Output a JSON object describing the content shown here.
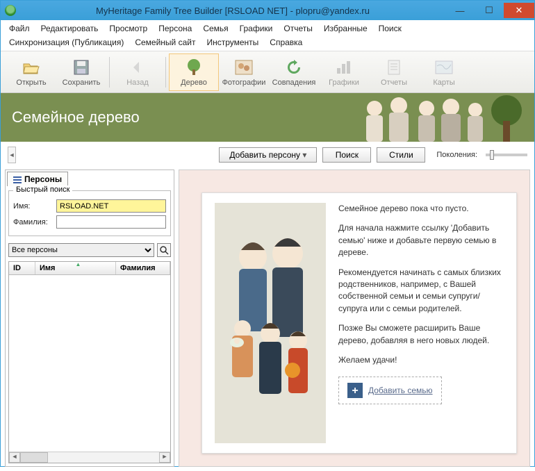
{
  "window": {
    "title": "MyHeritage Family Tree Builder [RSLOAD NET] - plopru@yandex.ru"
  },
  "menu": [
    "Файл",
    "Редактировать",
    "Просмотр",
    "Персона",
    "Семья",
    "Графики",
    "Отчеты",
    "Избранные",
    "Поиск",
    "Синхронизация (Публикация)",
    "Семейный сайт",
    "Инструменты",
    "Справка"
  ],
  "toolbar": {
    "open": "Открыть",
    "save": "Сохранить",
    "back": "Назад",
    "tree": "Дерево",
    "photos": "Фотографии",
    "matches": "Совпадения",
    "charts": "Графики",
    "reports": "Отчеты",
    "maps": "Карты"
  },
  "banner": {
    "title": "Семейное дерево"
  },
  "controls": {
    "addPerson": "Добавить персону",
    "search": "Поиск",
    "styles": "Стили",
    "generations": "Поколения:"
  },
  "sidebar": {
    "tab": "Персоны",
    "quickSearch": "Быстрый поиск",
    "nameLabel": "Имя:",
    "nameValue": "RSLOAD.NET",
    "surnameLabel": "Фамилия:",
    "surnameValue": "",
    "filter": "Все персоны",
    "cols": {
      "id": "ID",
      "name": "Имя",
      "surname": "Фамилия"
    }
  },
  "empty": {
    "p1": "Семейное дерево пока что пусто.",
    "p2": "Для начала нажмите ссылку 'Добавить семью' ниже и добавьте первую семью в дереве.",
    "p3": "Рекомендуется начинать с самых близких родственников, например, с Вашей собственной семьи и семьи супруги/супруга или с семьи родителей.",
    "p4": "Позже Вы сможете расширить Ваше дерево, добавляя в него новых людей.",
    "p5": "Желаем удачи!",
    "addFamily": "Добавить семью"
  }
}
